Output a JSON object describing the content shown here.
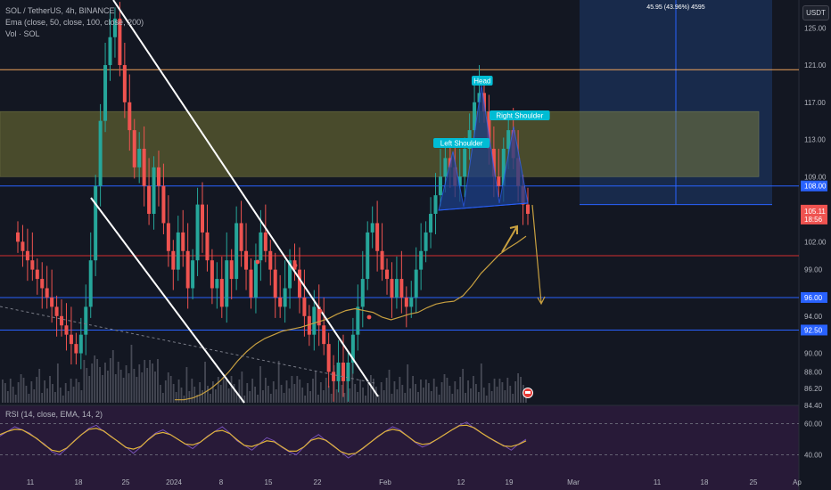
{
  "header": {
    "symbol_line": "SOL / TetherUS, 4h, BINANCE",
    "ema_line": "Ema (close, 50, close, 100, close, 200)",
    "vol_line": "Vol · SOL",
    "rsi_line": "RSI (14, close, EMA, 14, 2)",
    "currency_button": "USDT"
  },
  "colors": {
    "background": "#131722",
    "up_candle": "#26a69a",
    "down_candle": "#ef5350",
    "resistance_line": "#f0a35a",
    "support_line": "#2962ff",
    "red_line": "#d32f2f",
    "zone_fill": "#8b8b3a",
    "projection_box": "#1e3a6e",
    "ema_line": "#c8a040",
    "pattern_fill": "#1c3e86",
    "label_bg": "#00bcd4",
    "rsi_line": "#e0b33a",
    "rsi_fill": "#3b1d4a"
  },
  "chart_data": {
    "type": "candlestick",
    "title": "SOL / TetherUS, 4h, BINANCE",
    "x_tick_labels": [
      "11",
      "18",
      "25",
      "2024",
      "8",
      "15",
      "22",
      "Feb",
      "12",
      "19",
      "Mar",
      "11",
      "18",
      "25",
      "Ap"
    ],
    "y_tick_labels": [
      "125.00",
      "121.00",
      "117.00",
      "113.00",
      "109.00",
      "102.00",
      "99.00",
      "96.00",
      "94.00",
      "92.50",
      "90.00",
      "88.00",
      "86.20",
      "84.40"
    ],
    "ylim": [
      84.4,
      128
    ],
    "horizontal_levels": [
      {
        "value": 120.5,
        "color": "#f0a35a"
      },
      {
        "value": 108.0,
        "color": "#2962ff",
        "label": "108.00"
      },
      {
        "value": 96.0,
        "color": "#2962ff",
        "label": "96.00"
      },
      {
        "value": 92.5,
        "color": "#2962ff",
        "label": "92.50"
      },
      {
        "value": 100.5,
        "color": "#d32f2f"
      }
    ],
    "supply_zone": {
      "top": 116.0,
      "bottom": 109.0
    },
    "current_price": {
      "value": "105.11",
      "countdown": "18:56"
    },
    "projection": {
      "label": "45.95 (43.96%) 4595",
      "top": 128,
      "bottom": 106
    },
    "pattern_labels": [
      "Left Shoulder",
      "Head",
      "Right Shoulder"
    ],
    "close_series": [
      102,
      101,
      100,
      99,
      98,
      97,
      96,
      95,
      94,
      93,
      92,
      91,
      90,
      92,
      95,
      100,
      108,
      115,
      121,
      124,
      126,
      121,
      117,
      114,
      110,
      112,
      108,
      105,
      110,
      108,
      104,
      101,
      99,
      103,
      101,
      97,
      100,
      106,
      103,
      100,
      97,
      98,
      95,
      100,
      98,
      104,
      101,
      99,
      96,
      100,
      103,
      101,
      99,
      96,
      95,
      97,
      100,
      99,
      96,
      94,
      92,
      95,
      93,
      91,
      88,
      87,
      89,
      87,
      89,
      92,
      95,
      98,
      103,
      104,
      101,
      99,
      98,
      96,
      98,
      96,
      95,
      96,
      99,
      101,
      103,
      105,
      107,
      109,
      111,
      110,
      108,
      109,
      112,
      114,
      117,
      118,
      116,
      112,
      109,
      108,
      112,
      114,
      111,
      108,
      106,
      105
    ],
    "ema_series": [
      85,
      85,
      85.2,
      85.6,
      86.2,
      87,
      88,
      89.2,
      90.2,
      91,
      91.6,
      92,
      92.4,
      92.6,
      92.8,
      93.1,
      93.4,
      93.7,
      94.2,
      94.6,
      94.8,
      94.6,
      94.4,
      93.9,
      93.6,
      93.9,
      94.2,
      94.4,
      94.9,
      95.3,
      95.5,
      95.6,
      96.2,
      97.3,
      98.6,
      99.6,
      100.6,
      101.3,
      101.9,
      102.6
    ],
    "rsi_series": [
      52,
      55,
      58,
      56,
      54,
      50,
      47,
      42,
      40,
      44,
      49,
      53,
      57,
      59,
      55,
      52,
      48,
      45,
      41,
      45,
      50,
      54,
      56,
      53,
      50,
      47,
      44,
      48,
      52,
      55,
      58,
      54,
      49,
      46,
      43,
      47,
      51,
      49,
      45,
      42,
      40,
      45,
      50,
      53,
      49,
      46,
      42,
      38,
      41,
      44,
      48,
      52,
      55,
      58,
      56,
      52,
      48,
      45,
      47,
      50,
      53,
      56,
      59,
      61,
      57,
      54,
      51,
      48,
      46,
      43,
      47,
      50
    ],
    "rsi_ylim": [
      30,
      70
    ],
    "rsi_tick_labels": [
      "60.00",
      "40.00"
    ]
  }
}
